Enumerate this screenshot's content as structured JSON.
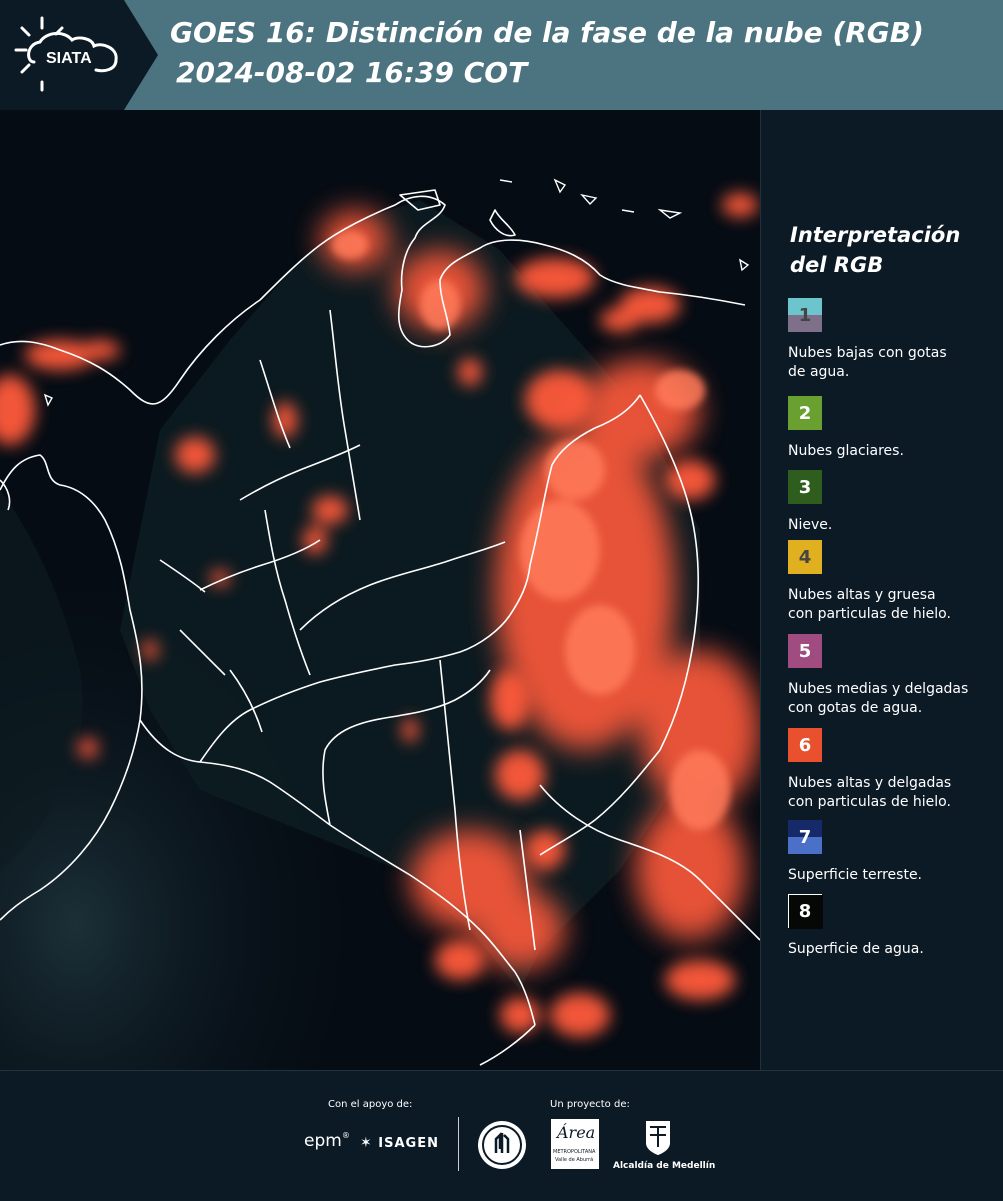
{
  "header": {
    "logo_text": "SIATA",
    "title_line1": "GOES 16: Distinción de la fase de la nube (RGB)",
    "title_line2": "2024-08-02 16:39 COT"
  },
  "map": {
    "colors": {
      "background": "#050c14",
      "cloud": "#ff5a3a",
      "cloud_core": "#ff7a5a",
      "border": "#ffffff",
      "land": "#0d1d22"
    }
  },
  "legend": {
    "title_line1": "Interpretación",
    "title_line2": "del RGB",
    "items": [
      {
        "number": "1",
        "label_line1": "Nubes bajas con gotas",
        "label_line2": "de agua.",
        "color_top": "#6cc4cc",
        "color_bottom": "#7e6f8a",
        "text_color": "#444444"
      },
      {
        "number": "2",
        "label_line1": "Nubes glaciares.",
        "label_line2": "",
        "color_top": "#6aa030",
        "color_bottom": "#6aa030",
        "text_color": "#ffffff"
      },
      {
        "number": "3",
        "label_line1": "Nieve.",
        "label_line2": "",
        "color_top": "#2e5d1e",
        "color_bottom": "#2e5d1e",
        "text_color": "#ffffff"
      },
      {
        "number": "4",
        "label_line1": "Nubes altas y gruesa",
        "label_line2": "con particulas de hielo.",
        "color_top": "#e0b020",
        "color_bottom": "#e0b020",
        "text_color": "#444444"
      },
      {
        "number": "5",
        "label_line1": "Nubes medias y delgadas",
        "label_line2": "con gotas de agua.",
        "color_top": "#a04c80",
        "color_bottom": "#a04c80",
        "text_color": "#ffffff"
      },
      {
        "number": "6",
        "label_line1": "Nubes altas y delgadas",
        "label_line2": "con particulas de hielo.",
        "color_top": "#e8502e",
        "color_bottom": "#e8502e",
        "text_color": "#ffffff"
      },
      {
        "number": "7",
        "label_line1": "Superficie terreste.",
        "label_line2": "",
        "color_top": "#162a6a",
        "color_bottom": "#4a70c8",
        "text_color": "#ffffff"
      },
      {
        "number": "8",
        "label_line1": "Superficie de agua.",
        "label_line2": "",
        "color_top": "#050805",
        "color_bottom": "#050805",
        "text_color": "#ffffff"
      }
    ]
  },
  "footer": {
    "support_label": "Con el apoyo de:",
    "project_label": "Un proyecto de:",
    "sponsor_epm": "epm",
    "sponsor_isagen": "ISAGEN",
    "sponsor_metropolitana_1": "Área",
    "sponsor_metropolitana_2": "METROPOLITANA",
    "sponsor_metropolitana_3": "Valle de Aburrá",
    "sponsor_alcaldia": "Alcaldía de Medellín"
  }
}
